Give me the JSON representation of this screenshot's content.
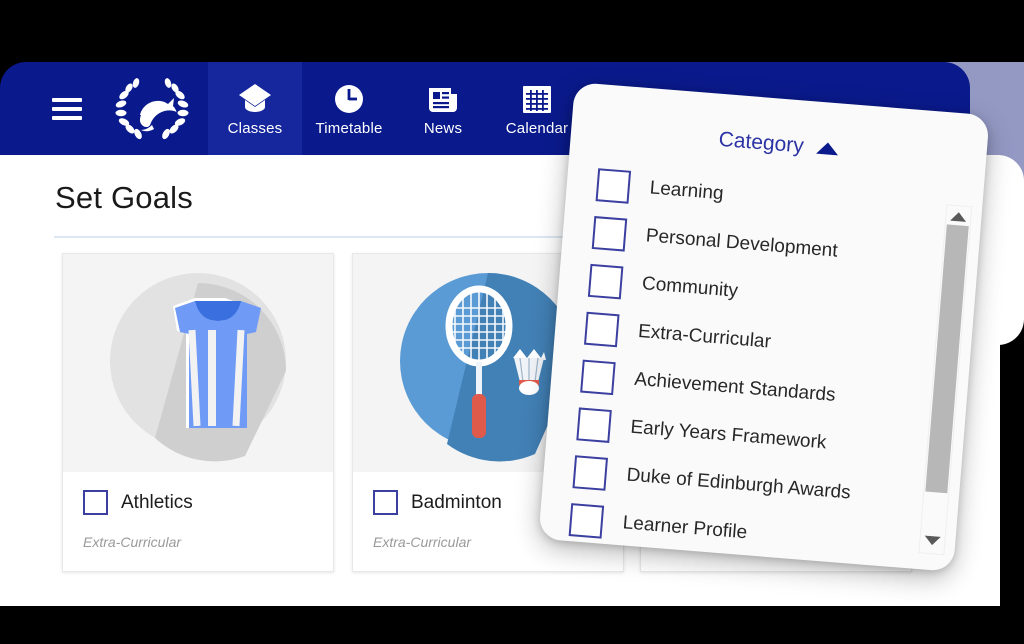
{
  "colors": {
    "navy": "#0a1a8c",
    "navy_active": "#16269c",
    "periwinkle": "#9499c4",
    "accent_indigo": "#3b3fa0",
    "divider": "#dce7f3",
    "card_thumb_bg": "#f4f4f4",
    "muted_text": "#9a9a9a",
    "scrollbar_thumb": "#b7b7b7"
  },
  "navbar": {
    "menu_icon": "hamburger-icon",
    "logo_icon": "school-crest-dolphin-laurel-logo",
    "items": [
      {
        "label": "Classes",
        "icon": "graduation-cap-icon",
        "active": true
      },
      {
        "label": "Timetable",
        "icon": "clock-icon",
        "active": false
      },
      {
        "label": "News",
        "icon": "newspaper-icon",
        "active": false
      },
      {
        "label": "Calendar",
        "icon": "calendar-icon",
        "active": false
      },
      {
        "label": "",
        "icon": "briefcase-icon",
        "active": false
      }
    ]
  },
  "main": {
    "title": "Set Goals",
    "cards": [
      {
        "name": "Athletics",
        "category": "Extra-Curricular",
        "icon": "athletics-tank-top-icon",
        "checked": false
      },
      {
        "name": "Badminton",
        "category": "Extra-Curricular",
        "icon": "badminton-racket-shuttlecock-icon",
        "checked": false
      },
      {
        "name": "",
        "category": "",
        "icon": "",
        "checked": false
      }
    ]
  },
  "dropdown": {
    "title": "Category",
    "caret_icon": "caret-up-icon",
    "options": [
      {
        "label": "Learning",
        "checked": false
      },
      {
        "label": "Personal Development",
        "checked": false
      },
      {
        "label": "Community",
        "checked": false
      },
      {
        "label": "Extra-Curricular",
        "checked": false
      },
      {
        "label": "Achievement Standards",
        "checked": false
      },
      {
        "label": "Early Years Framework",
        "checked": false
      },
      {
        "label": "Duke of Edinburgh Awards",
        "checked": false
      },
      {
        "label": "Learner Profile",
        "checked": false
      }
    ],
    "scrollbar": {
      "up_icon": "scroll-up-arrow-icon",
      "down_icon": "scroll-down-arrow-icon"
    }
  }
}
